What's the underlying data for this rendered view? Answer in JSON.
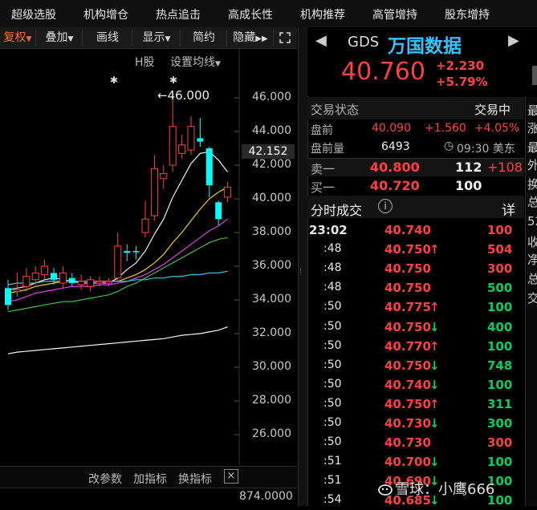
{
  "menu": [
    "超级选股",
    "机构增仓",
    "热点追击",
    "高成长性",
    "机构推荐",
    "高管增持",
    "股东增持"
  ],
  "toolbar": {
    "fuquan": "复权",
    "overlay": "叠加",
    "draw": "画线",
    "display": "显示",
    "simple": "简约",
    "hide": "隐藏",
    "expand_icon": "expand-icon"
  },
  "chart_sub": {
    "market": "H股",
    "ma_setting": "设置均线"
  },
  "chart_data": {
    "type": "candlestick",
    "y_ticks": [
      "46.000",
      "44.000",
      "42.000",
      "40.000",
      "38.000",
      "36.000",
      "34.000",
      "32.000",
      "30.000",
      "28.000",
      "26.000"
    ],
    "ylim": [
      24.5,
      47.5
    ],
    "current_price_label": "42.152",
    "high_annotation": "46.000",
    "volume_axis_label": "874.0000",
    "candles": [
      {
        "o": 33.7,
        "c": 34.7,
        "h": 35.2,
        "l": 33.4,
        "up": false
      },
      {
        "o": 34.6,
        "c": 34.5,
        "h": 35.6,
        "l": 34.2,
        "up": true
      },
      {
        "o": 34.8,
        "c": 35.4,
        "h": 35.9,
        "l": 34.5,
        "up": true
      },
      {
        "o": 35.2,
        "c": 35.6,
        "h": 36.0,
        "l": 34.9,
        "up": true
      },
      {
        "o": 35.5,
        "c": 36.0,
        "h": 36.4,
        "l": 35.2,
        "up": true
      },
      {
        "o": 35.6,
        "c": 35.2,
        "h": 35.9,
        "l": 34.9,
        "up": false
      },
      {
        "o": 35.0,
        "c": 35.6,
        "h": 36.0,
        "l": 34.7,
        "up": true
      },
      {
        "o": 35.3,
        "c": 35.0,
        "h": 35.6,
        "l": 34.8,
        "up": false
      },
      {
        "o": 35.1,
        "c": 34.9,
        "h": 35.5,
        "l": 34.6,
        "up": true
      },
      {
        "o": 34.8,
        "c": 35.2,
        "h": 35.4,
        "l": 34.5,
        "up": true
      },
      {
        "o": 35.0,
        "c": 35.1,
        "h": 35.4,
        "l": 34.8,
        "up": true
      },
      {
        "o": 35.1,
        "c": 35.0,
        "h": 35.3,
        "l": 34.8,
        "up": true
      },
      {
        "o": 35.3,
        "c": 37.2,
        "h": 38.0,
        "l": 35.1,
        "up": true
      },
      {
        "o": 36.8,
        "c": 36.9,
        "h": 37.3,
        "l": 36.3,
        "up": false
      },
      {
        "o": 36.9,
        "c": 36.9,
        "h": 37.2,
        "l": 36.4,
        "up": false
      },
      {
        "o": 38.0,
        "c": 38.8,
        "h": 39.9,
        "l": 37.7,
        "up": true
      },
      {
        "o": 39.0,
        "c": 41.8,
        "h": 42.6,
        "l": 38.7,
        "up": true
      },
      {
        "o": 41.2,
        "c": 41.5,
        "h": 42.0,
        "l": 40.6,
        "up": true
      },
      {
        "o": 42.0,
        "c": 44.3,
        "h": 46.0,
        "l": 41.6,
        "up": true
      },
      {
        "o": 42.7,
        "c": 43.2,
        "h": 43.8,
        "l": 42.4,
        "up": true
      },
      {
        "o": 42.9,
        "c": 44.3,
        "h": 44.9,
        "l": 42.6,
        "up": true
      },
      {
        "o": 43.6,
        "c": 43.4,
        "h": 44.8,
        "l": 43.1,
        "up": false
      },
      {
        "o": 43.0,
        "c": 40.8,
        "h": 43.1,
        "l": 40.1,
        "up": false
      },
      {
        "o": 39.8,
        "c": 38.8,
        "h": 39.9,
        "l": 38.4,
        "up": false
      },
      {
        "o": 40.1,
        "c": 40.7,
        "h": 41.0,
        "l": 39.8,
        "up": true
      }
    ],
    "ma_lines": [
      {
        "color": "#f0f0f0",
        "values": [
          34.6,
          34.7,
          34.8,
          35.0,
          35.2,
          35.3,
          35.2,
          35.1,
          35.0,
          35.0,
          35.0,
          35.0,
          35.3,
          35.8,
          36.2,
          36.9,
          37.9,
          38.8,
          40.1,
          41.1,
          42.1,
          42.7,
          42.8,
          42.3,
          41.6
        ]
      },
      {
        "color": "#f0d000",
        "values": [
          34.4,
          34.5,
          34.6,
          34.8,
          34.9,
          35.0,
          35.1,
          35.1,
          35.1,
          35.1,
          35.1,
          35.1,
          35.1,
          35.3,
          35.5,
          35.8,
          36.2,
          36.7,
          37.4,
          38.0,
          38.7,
          39.4,
          40.0,
          40.4,
          40.7
        ]
      },
      {
        "color": "#e040e0",
        "values": [
          33.9,
          34.0,
          34.2,
          34.4,
          34.5,
          34.6,
          34.7,
          34.8,
          34.8,
          34.8,
          34.9,
          34.9,
          35.0,
          35.1,
          35.3,
          35.5,
          35.8,
          36.1,
          36.5,
          36.9,
          37.3,
          37.7,
          38.1,
          38.4,
          38.8
        ]
      },
      {
        "color": "#40c040",
        "values": [
          33.3,
          33.4,
          33.5,
          33.6,
          33.7,
          33.8,
          33.9,
          33.9,
          34.0,
          34.1,
          34.2,
          34.3,
          34.5,
          34.8,
          35.0,
          35.3,
          35.6,
          35.9,
          36.2,
          36.5,
          36.8,
          37.1,
          37.4,
          37.6,
          37.7
        ]
      },
      {
        "color": "#40c0e0",
        "values": [
          34.9,
          35.0,
          35.0,
          35.0,
          35.1,
          35.1,
          35.1,
          35.1,
          35.1,
          35.1,
          35.1,
          35.1,
          35.1,
          35.1,
          35.2,
          35.2,
          35.3,
          35.3,
          35.4,
          35.4,
          35.5,
          35.5,
          35.6,
          35.6,
          35.7
        ]
      },
      {
        "color": "#f8f8f8",
        "values": [
          30.8,
          30.9,
          30.95,
          31.0,
          31.05,
          31.1,
          31.15,
          31.2,
          31.25,
          31.3,
          31.35,
          31.4,
          31.45,
          31.5,
          31.55,
          31.6,
          31.65,
          31.7,
          31.8,
          31.9,
          31.95,
          32.0,
          32.1,
          32.2,
          32.4
        ]
      }
    ]
  },
  "chart_footer": {
    "param": "改参数",
    "add_ind": "加指标",
    "switch_ind": "换指标",
    "close": "×"
  },
  "stock": {
    "code": "GDS",
    "name": "万国数据",
    "price": "40.760",
    "change": "+2.230",
    "change_pct": "+5.79%"
  },
  "status": {
    "label": "交易状态",
    "value": "交易中"
  },
  "premarket": {
    "label": "盘前",
    "price": "40.090",
    "change": "+1.560",
    "pct": "+4.05%",
    "vol_label": "盘前量",
    "vol": "6493",
    "time": "09:30 美东"
  },
  "orderbook": {
    "sell": {
      "label": "卖一",
      "price": "40.800",
      "qty": "112",
      "delta": "+108"
    },
    "buy": {
      "label": "买一",
      "price": "40.720",
      "qty": "100"
    }
  },
  "ticks_header": {
    "title": "分时成交",
    "detail": "详"
  },
  "ticks": [
    {
      "time": "23:02",
      "price": "40.740",
      "arrow": "",
      "qty": "100",
      "qc": "red"
    },
    {
      "time": ":48",
      "price": "40.750",
      "arrow": "up",
      "qty": "504",
      "qc": "red"
    },
    {
      "time": ":48",
      "price": "40.750",
      "arrow": "",
      "qty": "300",
      "qc": "red"
    },
    {
      "time": ":48",
      "price": "40.750",
      "arrow": "",
      "qty": "500",
      "qc": "green"
    },
    {
      "time": ":50",
      "price": "40.775",
      "arrow": "up",
      "qty": "100",
      "qc": "green"
    },
    {
      "time": ":50",
      "price": "40.750",
      "arrow": "down",
      "qty": "400",
      "qc": "green"
    },
    {
      "time": ":50",
      "price": "40.770",
      "arrow": "up",
      "qty": "100",
      "qc": "green"
    },
    {
      "time": ":50",
      "price": "40.750",
      "arrow": "down",
      "qty": "748",
      "qc": "green"
    },
    {
      "time": ":50",
      "price": "40.740",
      "arrow": "down",
      "qty": "100",
      "qc": "green"
    },
    {
      "time": ":50",
      "price": "40.750",
      "arrow": "up",
      "qty": "311",
      "qc": "green"
    },
    {
      "time": ":50",
      "price": "40.730",
      "arrow": "down",
      "qty": "300",
      "qc": "green"
    },
    {
      "time": ":50",
      "price": "40.730",
      "arrow": "",
      "qty": "300",
      "qc": "red"
    },
    {
      "time": ":51",
      "price": "40.700",
      "arrow": "down",
      "qty": "100",
      "qc": "green"
    },
    {
      "time": ":51",
      "price": "40.690",
      "arrow": "down",
      "qty": "100",
      "qc": "green"
    },
    {
      "time": ":54",
      "price": "40.685",
      "arrow": "down",
      "qty": "100",
      "qc": "green"
    }
  ],
  "edge_labels": [
    "最",
    "涨",
    "最",
    "外",
    "换",
    "总",
    "52",
    "收",
    "净",
    "总",
    "交"
  ],
  "watermark": "雪球：小鹰666",
  "colors": {
    "up": "#ff4040",
    "down": "#00ffff",
    "accent": "#33c3ff",
    "red": "#ff4040",
    "green": "#00d060"
  }
}
